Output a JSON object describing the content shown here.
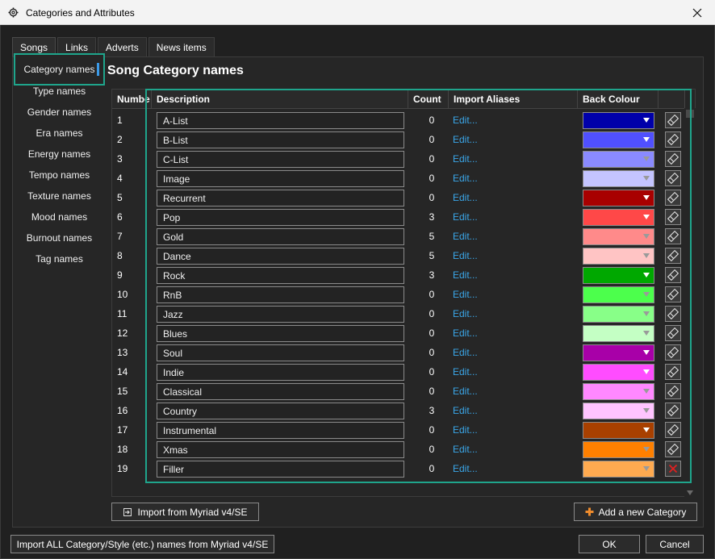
{
  "window": {
    "title": "Categories and Attributes"
  },
  "tabs": [
    {
      "label": "Songs",
      "active": true
    },
    {
      "label": "Links"
    },
    {
      "label": "Adverts"
    },
    {
      "label": "News items"
    }
  ],
  "subnav": [
    {
      "label": "Category names",
      "selected": true
    },
    {
      "label": "Type names"
    },
    {
      "label": "Gender names"
    },
    {
      "label": "Era names"
    },
    {
      "label": "Energy names"
    },
    {
      "label": "Tempo names"
    },
    {
      "label": "Texture names"
    },
    {
      "label": "Mood names"
    },
    {
      "label": "Burnout names"
    },
    {
      "label": "Tag names"
    }
  ],
  "section_title": "Song Category names",
  "grid": {
    "headers": {
      "number": "Numbe",
      "description": "Description",
      "count": "Count",
      "import_aliases": "Import Aliases",
      "back_colour": "Back Colour"
    },
    "edit_label": "Edit...",
    "rows": [
      {
        "number": "1",
        "description": "A-List",
        "count": "0",
        "colour": "#0000aa"
      },
      {
        "number": "2",
        "description": "B-List",
        "count": "0",
        "colour": "#5050ff"
      },
      {
        "number": "3",
        "description": "C-List",
        "count": "0",
        "colour": "#8a8aff"
      },
      {
        "number": "4",
        "description": "Image",
        "count": "0",
        "colour": "#c4c4ff"
      },
      {
        "number": "5",
        "description": "Recurrent",
        "count": "0",
        "colour": "#a80000"
      },
      {
        "number": "6",
        "description": "Pop",
        "count": "3",
        "colour": "#ff4848"
      },
      {
        "number": "7",
        "description": "Gold",
        "count": "5",
        "colour": "#ff8a8a"
      },
      {
        "number": "8",
        "description": "Dance",
        "count": "5",
        "colour": "#ffc4c4"
      },
      {
        "number": "9",
        "description": "Rock",
        "count": "3",
        "colour": "#00a800"
      },
      {
        "number": "10",
        "description": "RnB",
        "count": "0",
        "colour": "#4cff4c"
      },
      {
        "number": "11",
        "description": "Jazz",
        "count": "0",
        "colour": "#88ff88"
      },
      {
        "number": "12",
        "description": "Blues",
        "count": "0",
        "colour": "#c4ffc4"
      },
      {
        "number": "13",
        "description": "Soul",
        "count": "0",
        "colour": "#a800a8"
      },
      {
        "number": "14",
        "description": "Indie",
        "count": "0",
        "colour": "#ff4cff"
      },
      {
        "number": "15",
        "description": "Classical",
        "count": "0",
        "colour": "#ff88ff"
      },
      {
        "number": "16",
        "description": "Country",
        "count": "3",
        "colour": "#ffc4ff"
      },
      {
        "number": "17",
        "description": "Instrumental",
        "count": "0",
        "colour": "#a84000"
      },
      {
        "number": "18",
        "description": "Xmas",
        "count": "0",
        "colour": "#ff8000"
      },
      {
        "number": "19",
        "description": "Filler",
        "count": "0",
        "colour": "#ffaa50"
      }
    ]
  },
  "buttons": {
    "import_myriad": "Import from Myriad v4/SE",
    "add_category": "Add a new Category",
    "import_all": "Import ALL Category/Style (etc.) names from Myriad v4/SE",
    "ok": "OK",
    "cancel": "Cancel"
  },
  "colors": {
    "accent_highlight": "#1fa58c",
    "link": "#3aa6e8",
    "background": "#202020",
    "add_icon": "#f08c2c",
    "delete_icon": "#e02020"
  }
}
